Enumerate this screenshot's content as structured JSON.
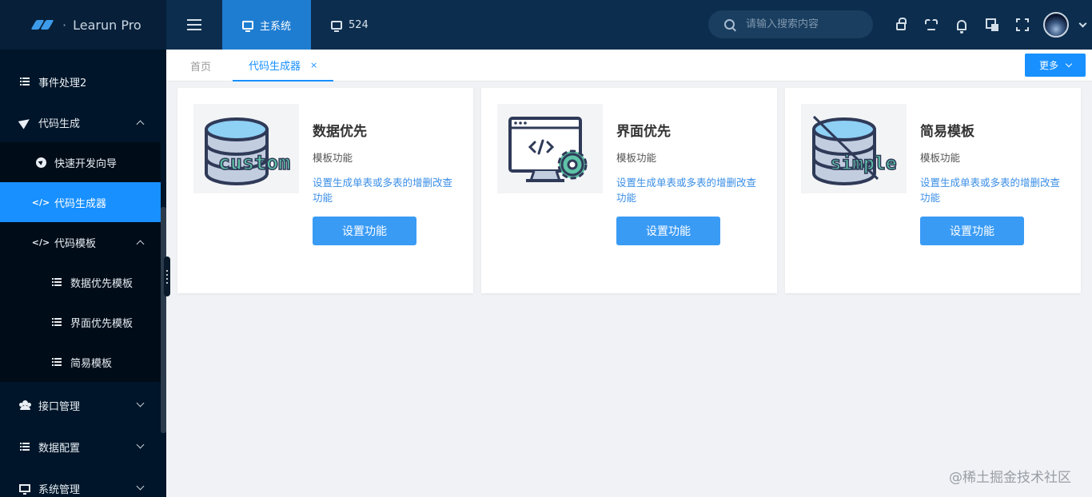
{
  "brand": {
    "name": "Learun Pro",
    "separator": "·"
  },
  "header": {
    "system_tabs": [
      {
        "label": "主系统",
        "active": true
      },
      {
        "label": "524",
        "active": false
      }
    ],
    "search": {
      "placeholder": "请输入搜索内容"
    },
    "icons": [
      "lock-icon",
      "skin-icon",
      "bell-icon",
      "translate-icon",
      "fullscreen-icon"
    ]
  },
  "sidebar": {
    "items": [
      {
        "label": "事件处理2",
        "icon": "list-icon",
        "level": 0
      },
      {
        "label": "代码生成",
        "icon": "send-icon",
        "level": 0,
        "expanded": true
      },
      {
        "label": "快速开发向导",
        "icon": "compass-icon",
        "level": 1
      },
      {
        "label": "代码生成器",
        "icon": "code-icon",
        "level": 1,
        "active": true
      },
      {
        "label": "代码模板",
        "icon": "code-icon",
        "level": 1,
        "expanded": true
      },
      {
        "label": "数据优先模板",
        "icon": "list-icon",
        "level": 2
      },
      {
        "label": "界面优先模板",
        "icon": "list-icon",
        "level": 2
      },
      {
        "label": "简易模板",
        "icon": "list-icon",
        "level": 2
      },
      {
        "label": "接口管理",
        "icon": "users-icon",
        "level": 0,
        "expanded": false
      },
      {
        "label": "数据配置",
        "icon": "list-icon",
        "level": 0,
        "expanded": false
      },
      {
        "label": "系统管理",
        "icon": "monitor-icon",
        "level": 0,
        "expanded": false
      }
    ],
    "code_glyph": "</>"
  },
  "page_tabs": [
    {
      "label": "首页",
      "active": false
    },
    {
      "label": "代码生成器",
      "active": true,
      "close": "×"
    }
  ],
  "more_button": {
    "label": "更多"
  },
  "cards": [
    {
      "title": "数据优先",
      "subtitle": "模板功能",
      "desc": "设置生成单表或多表的增删改查功能",
      "button": "设置功能",
      "image_text": "custom"
    },
    {
      "title": "界面优先",
      "subtitle": "模板功能",
      "desc": "设置生成单表或多表的增删改查功能",
      "button": "设置功能",
      "image_text": ""
    },
    {
      "title": "简易模板",
      "subtitle": "模板功能",
      "desc": "设置生成单表或多表的增删改查功能",
      "button": "设置功能",
      "image_text": "simple"
    }
  ],
  "watermark": "@稀土掘金技术社区",
  "colors": {
    "header": "#0c2d4d",
    "sidebar": "#001529",
    "accent": "#1890ff",
    "button": "#3a9bf5",
    "link": "#3a8ee6"
  }
}
